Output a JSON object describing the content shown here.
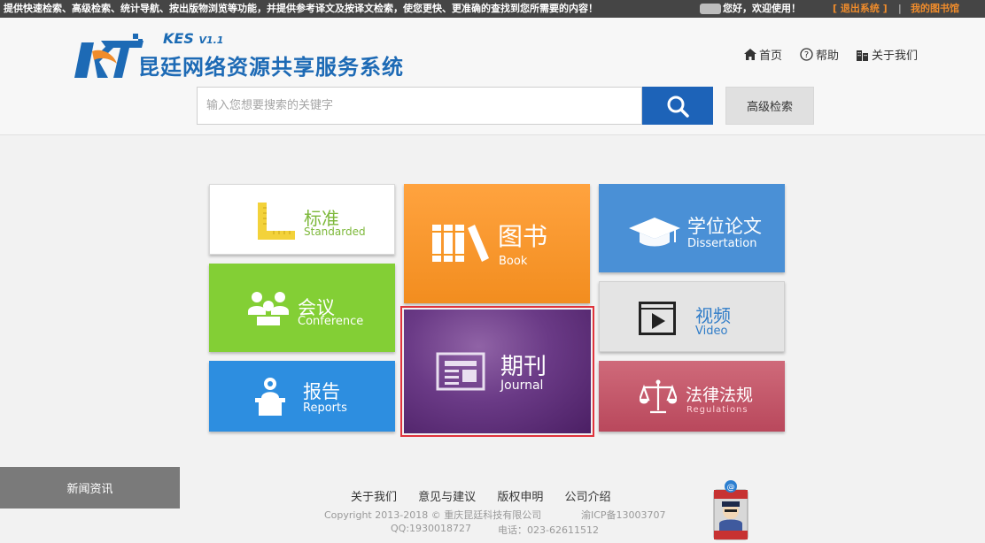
{
  "topbar": {
    "notice": "提供快速检索、高级检索、统计导航、按出版物浏览等功能，并提供参考译文及按译文检索，使您更快、更准确的查找到您所需要的内容！",
    "greeting": "您好，欢迎使用！",
    "logout": "[ 退出系统 ]",
    "separator": "|",
    "my_library": "我的图书馆"
  },
  "logo": {
    "product": "KES",
    "version": "V1.1",
    "name": "昆廷网络资源共享服务系统"
  },
  "nav": {
    "home": "首页",
    "help": "帮助",
    "about": "关于我们"
  },
  "search": {
    "placeholder": "输入您想要搜索的关键字",
    "value": "",
    "advanced_label": "高级检索"
  },
  "tiles": {
    "standard": {
      "cn": "标准",
      "en": "Standarded"
    },
    "book": {
      "cn": "图书",
      "en": "Book"
    },
    "thesis": {
      "cn": "学位论文",
      "en": "Dissertation"
    },
    "conference": {
      "cn": "会议",
      "en": "Conference"
    },
    "video": {
      "cn": "视频",
      "en": "Video"
    },
    "journal": {
      "cn": "期刊",
      "en": "Journal"
    },
    "report": {
      "cn": "报告",
      "en": "Reports"
    },
    "law": {
      "cn": "法律法规",
      "en": "Regulations"
    }
  },
  "news_tab": "新闻资讯",
  "footer": {
    "links": [
      "关于我们",
      "意见与建议",
      "版权申明",
      "公司介绍"
    ],
    "copyright": "Copyright 2013-2018 © 重庆昆廷科技有限公司",
    "icp": "渝ICP备13003707",
    "qq": "QQ:1930018727",
    "phone": "电话：023-62611512"
  },
  "colors": {
    "brand_blue": "#1d63b8",
    "accent_orange": "#f08c2b",
    "selection_red": "#e0333c"
  }
}
